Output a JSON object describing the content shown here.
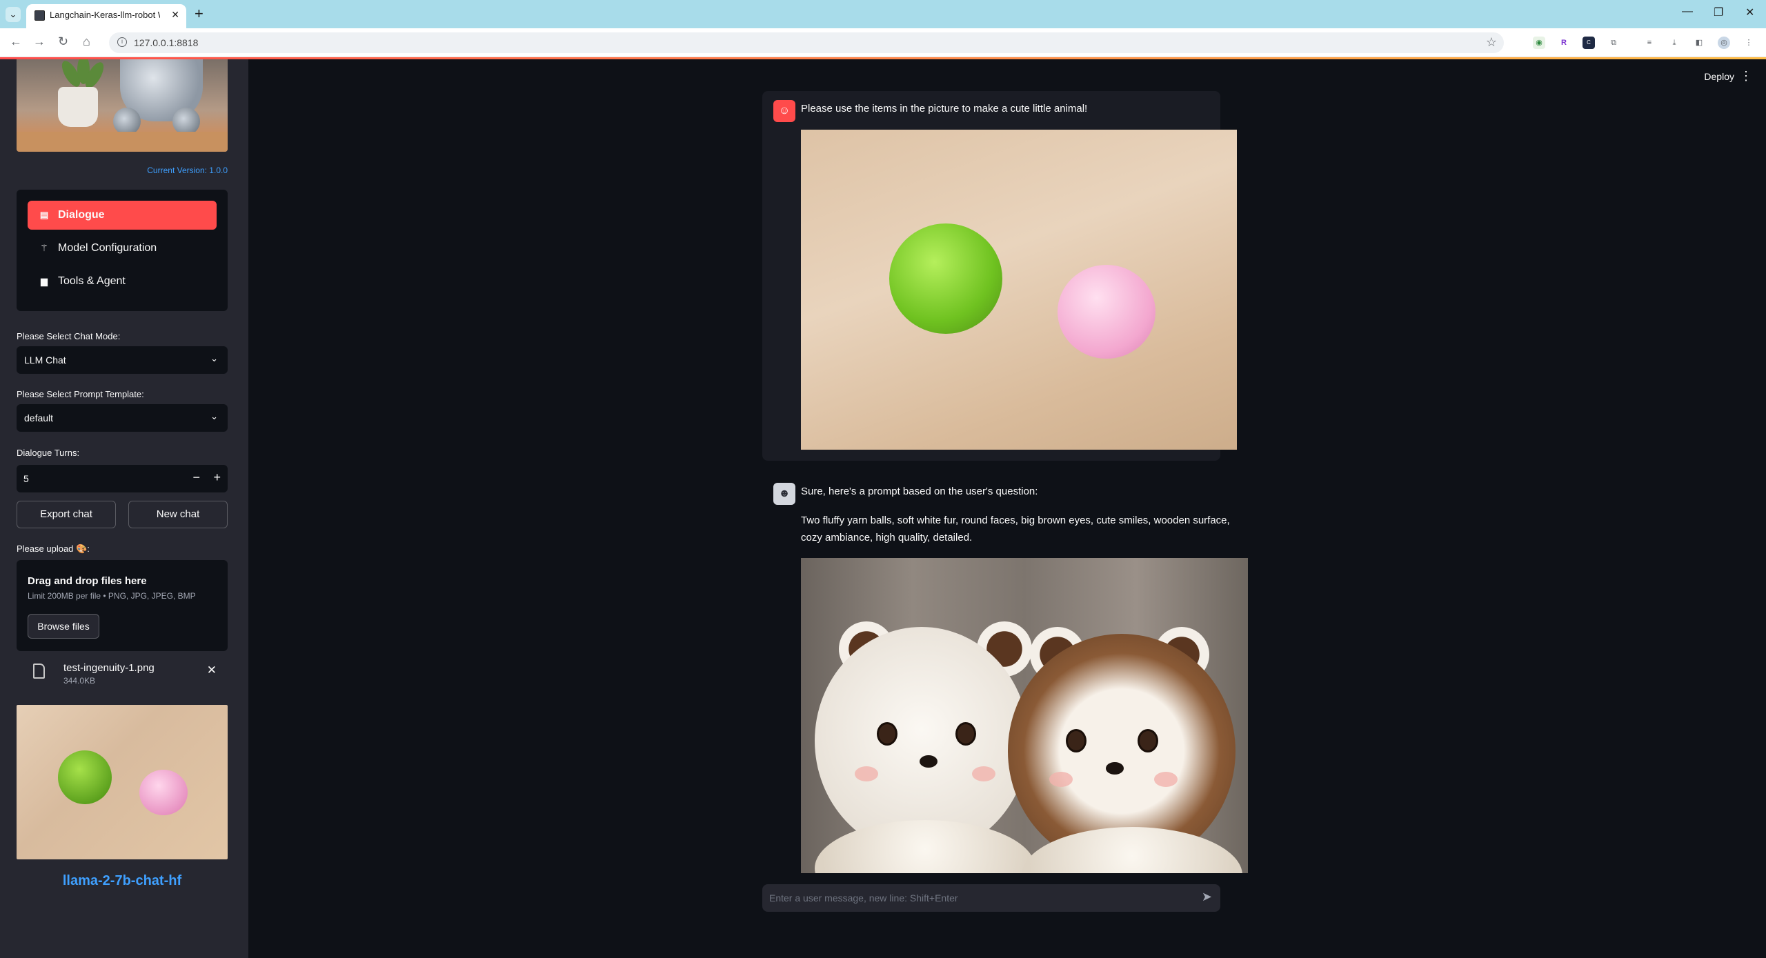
{
  "browser": {
    "tab_title": "Langchain-Keras-llm-robot We",
    "url": "127.0.0.1:8818"
  },
  "sidebar": {
    "version": "Current Version: 1.0.0",
    "nav": [
      {
        "label": "Dialogue",
        "icon": "chat-icon",
        "active": true
      },
      {
        "label": "Model Configuration",
        "icon": "magic-wand-icon",
        "active": false
      },
      {
        "label": "Tools & Agent",
        "icon": "toolbox-icon",
        "active": false
      }
    ],
    "chat_mode_label": "Please Select Chat Mode:",
    "chat_mode_value": "LLM Chat",
    "prompt_template_label": "Please Select Prompt Template:",
    "prompt_template_value": "default",
    "turns_label": "Dialogue Turns:",
    "turns_value": "5",
    "export_label": "Export chat",
    "new_chat_label": "New chat",
    "upload_label": "Please upload 🎨:",
    "upload_title": "Drag and drop files here",
    "upload_limit": "Limit 200MB per file • PNG, JPG, JPEG, BMP",
    "browse_label": "Browse files",
    "file_name": "test-ingenuity-1.png",
    "file_size": "344.0KB",
    "model_name": "llama-2-7b-chat-hf"
  },
  "header": {
    "deploy_label": "Deploy"
  },
  "chat": {
    "user_message": "Please use the items in the picture to make a cute little animal!",
    "assistant_intro": "Sure, here's a prompt based on the user's question:",
    "assistant_prompt_line1": "Two fluffy yarn balls, soft white fur, round faces, big brown eyes, cute smiles, wooden surface,",
    "assistant_prompt_line2": "cozy ambiance, high quality, detailed.",
    "input_placeholder": "Enter a user message, new line: Shift+Enter"
  },
  "colors": {
    "accent": "#ff4b4b",
    "link": "#3fa0ff",
    "background": "#0e1117",
    "sidebar": "#262730"
  }
}
